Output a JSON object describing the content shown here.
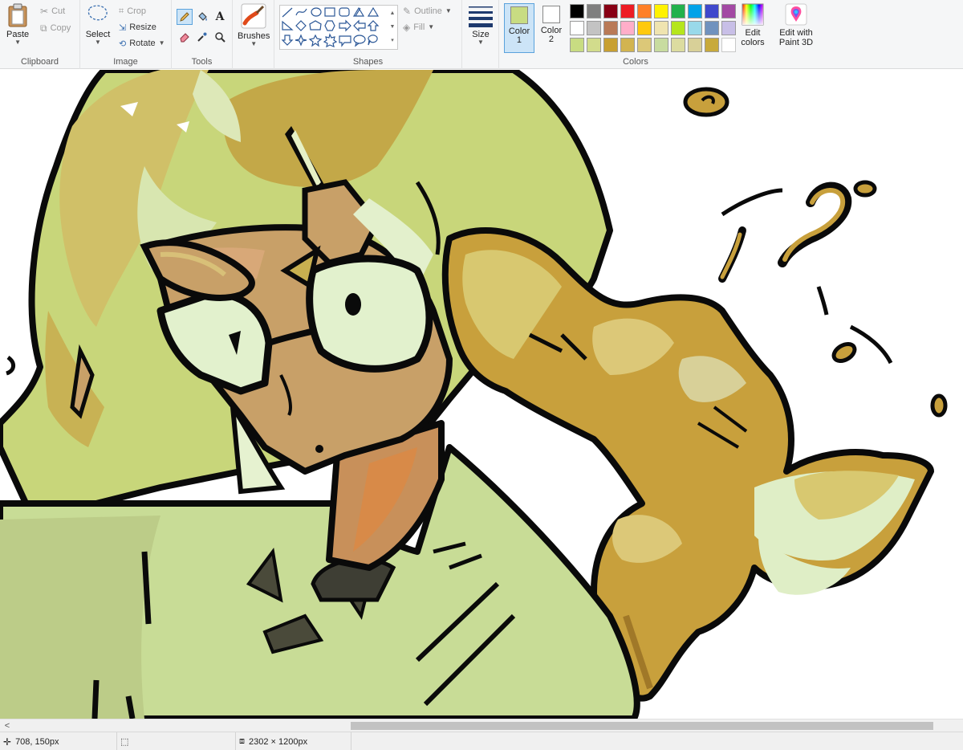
{
  "ribbon": {
    "clipboard": {
      "group_label": "Clipboard",
      "paste": "Paste",
      "cut": "Cut",
      "copy": "Copy"
    },
    "image": {
      "group_label": "Image",
      "select": "Select",
      "crop": "Crop",
      "resize": "Resize",
      "rotate": "Rotate"
    },
    "tools": {
      "group_label": "Tools",
      "active_tool": "pencil-icon"
    },
    "brushes": {
      "label": "Brushes"
    },
    "shapes": {
      "group_label": "Shapes",
      "outline": "Outline",
      "fill": "Fill"
    },
    "size": {
      "label": "Size"
    },
    "colors": {
      "group_label": "Colors",
      "color1": {
        "label": "Color",
        "index": "1",
        "value": "#c8dc82"
      },
      "color2": {
        "label": "Color",
        "index": "2",
        "value": "#ffffff"
      },
      "edit_colors": "Edit colors",
      "palette_row1": [
        "#000000",
        "#7f7f7f",
        "#880015",
        "#ed1c24",
        "#ff7f27",
        "#fff200",
        "#22b14c",
        "#00a2e8",
        "#3f48cc",
        "#a349a4"
      ],
      "palette_row2": [
        "#ffffff",
        "#c3c3c3",
        "#b97a57",
        "#ffaec9",
        "#ffc90e",
        "#efe4b0",
        "#b5e61d",
        "#99d9ea",
        "#7092be",
        "#c8bfe7"
      ],
      "palette_row3": [
        "#c8dc82",
        "#d2dc8c",
        "#c8a032",
        "#d2b450",
        "#dcc878",
        "#c8dca0",
        "#dcdca0",
        "#d8d098",
        "#c8aa3c",
        ""
      ]
    },
    "paint3d": {
      "label": "Edit with Paint 3D"
    }
  },
  "statusbar": {
    "cursor_position": "708, 150px",
    "selection_size": "",
    "image_size": "2302 × 1200px"
  }
}
